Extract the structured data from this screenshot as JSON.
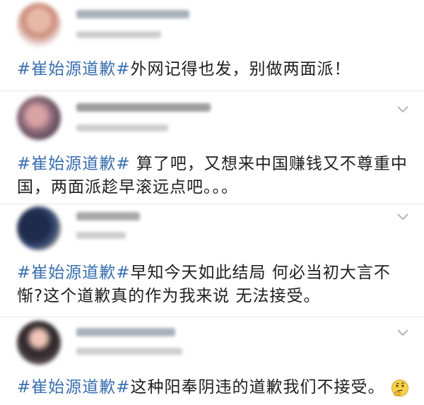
{
  "comments": [
    {
      "hashtag": "#崔始源道歉#",
      "body": "外网记得也发，别做两面派！",
      "has_emoji": false
    },
    {
      "hashtag": "#崔始源道歉#",
      "body": " 算了吧，又想来中国赚钱又不尊重中国，两面派趁早滚远点吧。。。",
      "has_emoji": false
    },
    {
      "hashtag": "#崔始源道歉#",
      "body": "早知今天如此结局 何必当初大言不惭?这个道歉真的作为我来说 无法接受。",
      "has_emoji": false
    },
    {
      "hashtag": "#崔始源道歉#",
      "body": "这种阳奉阴违的道歉我们不接受。",
      "has_emoji": true,
      "emoji_icon": "thinking-face-icon"
    }
  ],
  "colors": {
    "hashtag": "#3a6fb0",
    "text": "#1e1e1e",
    "separator": "#e8e8e8",
    "chevron": "#b5b5b5"
  }
}
